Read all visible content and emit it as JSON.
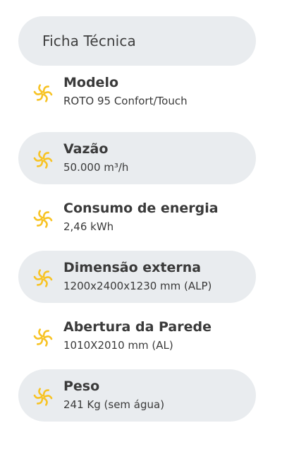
{
  "header": {
    "title": "Ficha Técnica"
  },
  "accent_color": "#f7c325",
  "row_shade_color": "#e9ecef",
  "specs": [
    {
      "label": "Modelo",
      "value": "ROTO 95 Confort/Touch",
      "icon": "fan-icon",
      "shaded": false
    },
    {
      "label": "Vazão",
      "value": "50.000 m³/h",
      "icon": "fan-icon",
      "shaded": true
    },
    {
      "label": "Consumo de energia",
      "value": "2,46 kWh",
      "icon": "fan-icon",
      "shaded": false
    },
    {
      "label": "Dimensão externa",
      "value": "1200x2400x1230 mm (ALP)",
      "icon": "fan-icon",
      "shaded": true
    },
    {
      "label": "Abertura da Parede",
      "value": "1010X2010 mm (AL)",
      "icon": "fan-icon",
      "shaded": false
    },
    {
      "label": "Peso",
      "value": "241 Kg (sem água)",
      "icon": "fan-icon",
      "shaded": true
    }
  ]
}
